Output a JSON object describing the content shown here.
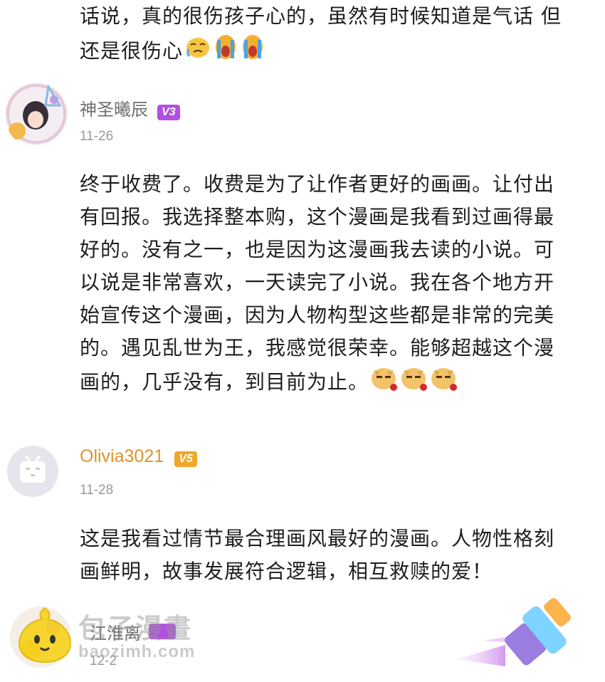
{
  "comments": [
    {
      "text_partial": "话说，真的很伤孩子心的，虽然有时候知道是气话 但还是很伤心",
      "emojis": [
        "cry-icon",
        "wail-icon",
        "wail-icon"
      ]
    },
    {
      "user": "神圣曦辰",
      "level": "V3",
      "date": "11-26",
      "text": "终于收费了。收费是为了让作者更好的画画。让付出有回报。我选择整本购，这个漫画是我看到过画得最好的。没有之一，也是因为这漫画我去读的小说。可以说是非常喜欢，一天读完了小说。我在各个地方开始宣传这个漫画，因为人物构型这些都是非常的完美的。遇见乱世为王，我感觉很荣幸。能够超越这个漫画的，几乎没有，到目前为止。",
      "emojis": [
        "doge-rose-icon",
        "doge-rose-icon",
        "doge-rose-icon"
      ]
    },
    {
      "user": "Olivia3021",
      "level": "V5",
      "date": "11-28",
      "text": "这是我看过情节最合理画风最好的漫画。人物性格刻画鲜明，故事发展符合逻辑，相互救赎的爱！"
    },
    {
      "user": "江淮离",
      "date": "12-2"
    }
  ],
  "lines": {
    "c0": [
      "话说，真的很伤孩子心的，虽然有时候知道是气话 但",
      "还是很伤心"
    ],
    "c1": [
      "终于收费了。收费是为了让作者更好的画画。让付出",
      "有回报。我选择整本购，这个漫画是我看到过画得最",
      "好的。没有之一，也是因为这漫画我去读的小说。可",
      "以说是非常喜欢，一天读完了小说。我在各个地方开",
      "始宣传这个漫画，因为人物构型这些都是非常的完美",
      "的。遇见乱世为王，我感觉很荣幸。能够超越这个漫",
      "画的，几乎没有，到目前为止。"
    ],
    "c2": [
      "这是我看过情节最合理画风最好的漫画。人物性格刻",
      "画鲜明，故事发展符合逻辑，相互救赎的爱！"
    ]
  },
  "watermark": {
    "title": "包子漫畫",
    "url": "baozimh.com"
  },
  "colors": {
    "v3": "#b44fe0",
    "v5": "#f0a82a",
    "brush": "#c06ee8"
  }
}
